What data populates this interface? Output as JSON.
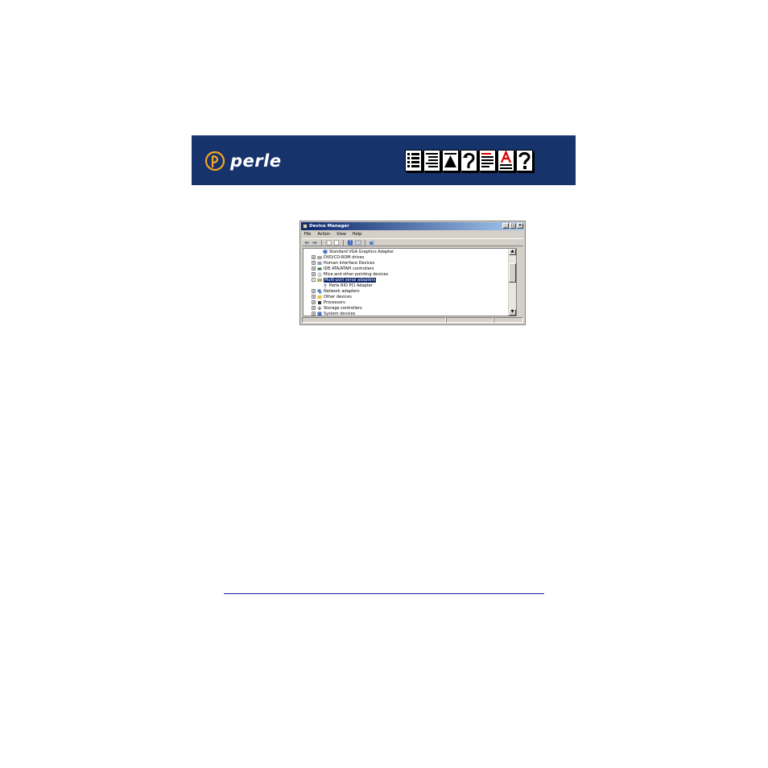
{
  "banner": {
    "logo_text": "perle",
    "nav_icons": [
      "contents-icon",
      "index-icon",
      "top-icon",
      "back-icon",
      "list-of-figures-icon",
      "glossary-icon",
      "help-icon"
    ],
    "background_color": "#17336b"
  },
  "window": {
    "title": "Device Manager",
    "controls": [
      "_",
      "□",
      "×"
    ],
    "menu": [
      "File",
      "Action",
      "View",
      "Help"
    ],
    "tree": [
      {
        "label": "Standard VGA Graphics Adapter",
        "level": 2,
        "expander": "",
        "icon": "display-adapter-icon"
      },
      {
        "label": "DVD/CD-ROM drives",
        "level": 1,
        "expander": "+",
        "icon": "dvd-drive-icon"
      },
      {
        "label": "Human Interface Devices",
        "level": 1,
        "expander": "+",
        "icon": "hid-icon"
      },
      {
        "label": "IDE ATA/ATAPI controllers",
        "level": 1,
        "expander": "+",
        "icon": "ide-controller-icon"
      },
      {
        "label": "Mice and other pointing devices",
        "level": 1,
        "expander": "+",
        "icon": "mouse-icon"
      },
      {
        "label": "Multi-port serial adapters",
        "level": 1,
        "expander": "-",
        "icon": "serial-adapter-icon",
        "selected": true
      },
      {
        "label": "Perle RIO PCI Adapter",
        "level": 2,
        "expander": "",
        "icon": "pci-adapter-icon"
      },
      {
        "label": "Network adapters",
        "level": 1,
        "expander": "+",
        "icon": "network-adapter-icon"
      },
      {
        "label": "Other devices",
        "level": 1,
        "expander": "+",
        "icon": "other-devices-icon"
      },
      {
        "label": "Processors",
        "level": 1,
        "expander": "+",
        "icon": "processor-icon"
      },
      {
        "label": "Storage controllers",
        "level": 1,
        "expander": "+",
        "icon": "storage-controller-icon"
      },
      {
        "label": "System devices",
        "level": 1,
        "expander": "+",
        "icon": "system-devices-icon"
      }
    ],
    "scroll_up": "▲",
    "scroll_down": "▼",
    "selection_color": "#0a246a"
  }
}
